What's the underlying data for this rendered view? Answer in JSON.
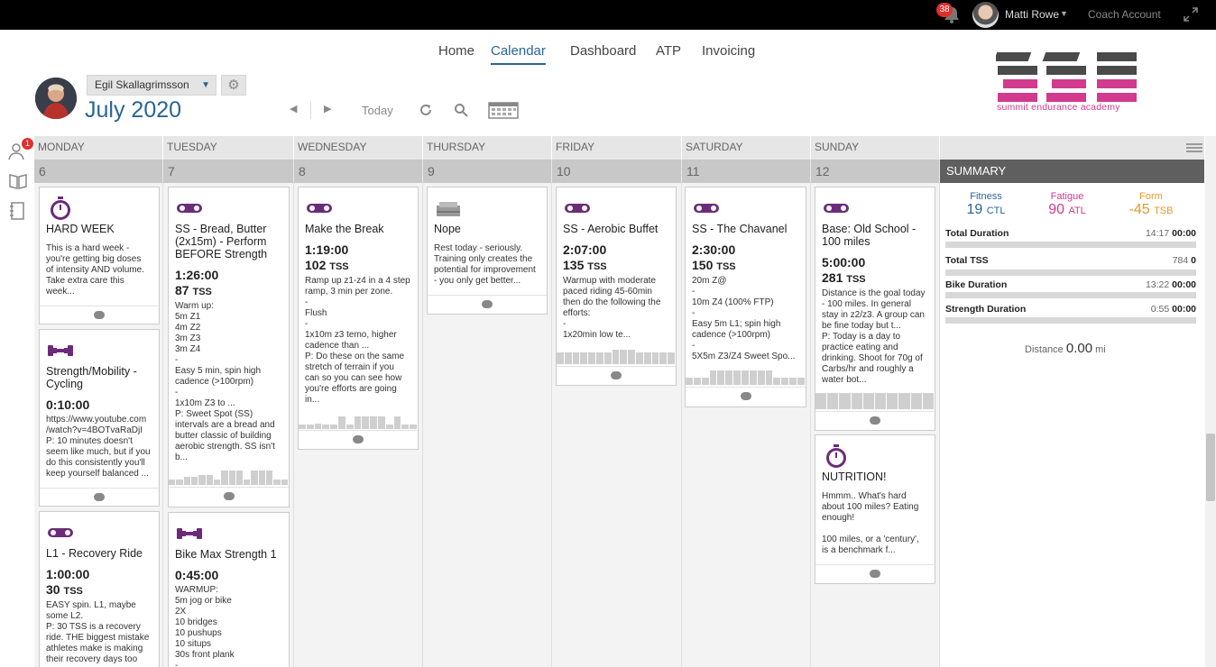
{
  "topbar": {
    "notification_count": "38",
    "user_name": "Matti Rowe",
    "coach_account": "Coach Account"
  },
  "nav": [
    "Home",
    "Calendar",
    "Dashboard",
    "ATP",
    "Invoicing"
  ],
  "athlete": {
    "name": "Egil Skallagrimsson",
    "month": "July",
    "year": "2020"
  },
  "toolbar": {
    "today_label": "Today"
  },
  "logo": {
    "text": "summit endurance academy"
  },
  "leftrail": {
    "badge": "1"
  },
  "days": [
    "MONDAY",
    "TUESDAY",
    "WEDNESDAY",
    "THURSDAY",
    "FRIDAY",
    "SATURDAY",
    "SUNDAY"
  ],
  "dates": [
    "6",
    "7",
    "8",
    "9",
    "10",
    "11",
    "12"
  ],
  "cards": [
    {
      "icon": "stopwatch",
      "title": "HARD WEEK",
      "desc": "This is a hard week -\nyou're getting big doses\nof intensity AND volume.\nTake extra care this\nweek..."
    },
    {
      "icon": "dumbbell",
      "title": "Strength/Mobility -\nCycling",
      "duration": "0:10:00",
      "desc": "https://www.youtube.com\n/watch?v=4BOTvaRaDjI\nP: 10 minutes doesn't\nseem like much, but if you\ndo this consistently you'll\nkeep yourself balanced ..."
    },
    {
      "icon": "bike",
      "title": "L1 - Recovery Ride",
      "duration": "1:00:00",
      "tss": "30",
      "desc": "EASY spin. L1, maybe\nsome L2.\nP: 30 TSS is a recovery\nride. THE biggest mistake\nathletes make is making\ntheir recovery days too"
    },
    {
      "icon": "bike",
      "title": "SS - Bread, Butter\n(2x15m) - Perform\nBEFORE Strength",
      "duration": "1:26:00",
      "tss": "87",
      "desc": "Warm up:\n5m Z1\n4m Z2\n3m Z3\n3m Z4\n-\nEasy 5 min, spin high\ncadence (>100rpm)\n-\n1x10m Z3 to ...\nP: Sweet Spot (SS)\nintervals are a bread and\nbutter classic of building\naerobic strength. SS isn't\nb..."
    },
    {
      "icon": "dumbbell",
      "title": "Bike Max Strength 1",
      "duration": "0:45:00",
      "desc": "WARMUP:\n5m jog or bike\n2X\n10 bridges\n10 pushups\n10 situps\n30s front plank\n-"
    },
    {
      "icon": "bike",
      "title": "Make the Break",
      "duration": "1:19:00",
      "tss": "102",
      "desc": "Ramp up z1-z4 in a 4 step\nramp, 3 min per zone.\n-\nFlush\n-\n1x10m z3 temo, higher\ncadence than ...\nP: Do these on the same\nstretch of terrain if you\ncan so you can see how\nyou're efforts are going\nin..."
    },
    {
      "icon": "rest",
      "title": "Nope",
      "desc": "Rest today - seriously.\nTraining only creates the\npotential for improvement\n- you only get better..."
    },
    {
      "icon": "bike",
      "title": "SS - Aerobic Buffet",
      "duration": "2:07:00",
      "tss": "135",
      "desc": "Warmup with moderate\npaced riding 45-60min\nthen do the following the\nefforts:\n-\n1x20min low te..."
    },
    {
      "icon": "bike",
      "title": "SS - The Chavanel",
      "duration": "2:30:00",
      "tss": "150",
      "desc": "20m Z@\n-\n10m Z4 (100% FTP)\n-\nEasy 5m L1; spin high\ncadence (>100rpm)\n-\n5X5m Z3/Z4 Sweet Spo..."
    },
    {
      "icon": "bike",
      "title": "Base: Old School -\n100 miles",
      "duration": "5:00:00",
      "tss": "281",
      "desc": "Distance is the goal today\n- 100 miles. In general\nstay in z2/z3. A group can\nbe fine today but t...\nP: Today is a day to\npractice eating and\ndrinking. Shoot for 70g of\nCarbs/hr and roughly a\nwater bot..."
    },
    {
      "icon": "stopwatch",
      "title": "NUTRITION!",
      "desc": "Hmmm.. What's hard\nabout 100 miles? Eating\nenough!\n\n100 miles, or a 'century',\nis a benchmark f..."
    }
  ],
  "tss_unit": "TSS",
  "summary": {
    "header": "SUMMARY",
    "fitness": {
      "label": "Fitness",
      "value": "19",
      "unit": "CTL",
      "color": "#2a6496"
    },
    "fatigue": {
      "label": "Fatigue",
      "value": "90",
      "unit": "ATL",
      "color": "#d23a8d"
    },
    "form": {
      "label": "Form",
      "value": "-45",
      "unit": "TSB",
      "color": "#e8962a"
    },
    "rows": [
      {
        "label": "Total Duration",
        "planned": "14:17",
        "completed": "00:00"
      },
      {
        "label": "Total TSS",
        "planned": "784",
        "completed": "0"
      },
      {
        "label": "Bike Duration",
        "planned": "13:22",
        "completed": "00:00"
      },
      {
        "label": "Strength Duration",
        "planned": "0:55",
        "completed": "00:00"
      }
    ],
    "distance": {
      "label": "Distance",
      "value": "0.00",
      "unit": "mi"
    }
  }
}
